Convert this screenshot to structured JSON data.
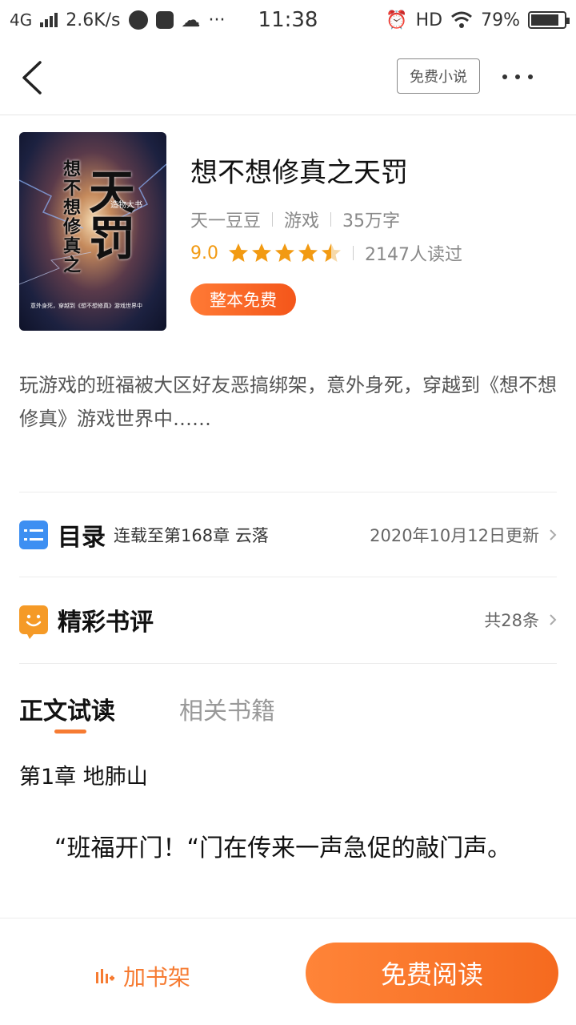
{
  "status_bar": {
    "network": "4G",
    "speed": "2.6K/s",
    "time": "11:38",
    "hd": "HD",
    "battery": "79%"
  },
  "nav": {
    "free_novel_label": "免费小说"
  },
  "book": {
    "title": "想不想修真之天罚",
    "author": "天一豆豆",
    "category": "游戏",
    "word_count": "35万字",
    "score": "9.0",
    "stars": 4.5,
    "readers": "2147人读过",
    "badge": "整本免费",
    "cover": {
      "title_big": "天罚",
      "title_small": "想不想修真之",
      "author_text": "造物大书",
      "blurb": "意外身死，穿越到《想不想修真》游戏世界中"
    },
    "description": "玩游戏的班福被大区好友恶搞绑架，意外身死，穿越到《想不想修真》游戏世界中……"
  },
  "toc": {
    "title": "目录",
    "latest": "连载至第168章 云落",
    "updated": "2020年10月12日更新"
  },
  "reviews": {
    "title": "精彩书评",
    "count": "共28条"
  },
  "tabs": {
    "active": "正文试读",
    "inactive": "相关书籍"
  },
  "preview": {
    "chapter_title": "第1章 地肺山",
    "text": "“班福开门！“门在传来一声急促的敲门声。"
  },
  "bottom_bar": {
    "shelf_label": "加书架",
    "read_label": "免费阅读"
  },
  "colors": {
    "accent": "#f67b32",
    "star": "#f29a12",
    "toc_icon": "#3d8ff2"
  }
}
